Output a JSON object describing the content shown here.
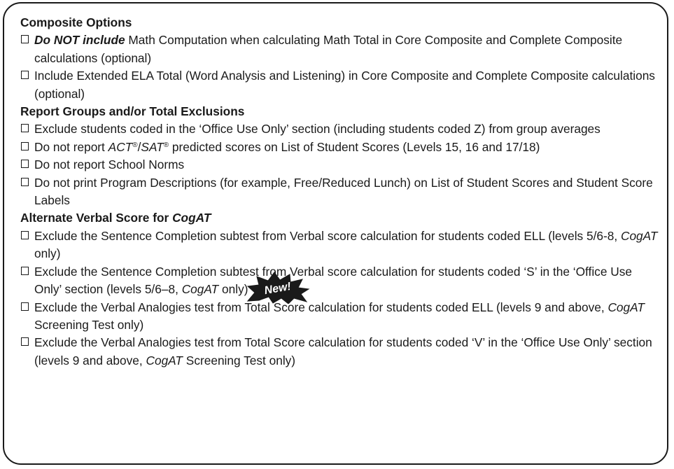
{
  "sections": [
    {
      "title": "Composite Options",
      "options": [
        {
          "prefix": "Do NOT include",
          "text": " Math Computation when calculating Math Total in Core Composite and Complete Composite calculations (optional)"
        },
        {
          "text": "Include Extended ELA Total (Word Analysis and Listening) in Core Composite and Complete Composite calculations (optional)"
        }
      ]
    },
    {
      "title": "Report Groups and/or Total Exclusions",
      "options": [
        {
          "text": "Exclude students coded in the ‘Office Use Only’ section (including students coded Z) from group averages"
        },
        {
          "pre": "Do not report ",
          "act": "ACT",
          "reg1": "®",
          "slash": "/",
          "sat": "SAT",
          "reg2": "®",
          "post": " predicted scores on List of Student Scores (Levels 15, 16 and 17/18)"
        },
        {
          "text": "Do not report School Norms"
        },
        {
          "text": "Do not print Program Descriptions (for example, Free/Reduced Lunch) on List of Student Scores and Student Score Labels"
        }
      ]
    },
    {
      "title_pre": "Alternate Verbal Score for ",
      "title_em": "CogAT",
      "badge": "New!",
      "options": [
        {
          "a": "Exclude the Sentence Completion subtest from Verbal score calculation for students coded ELL (levels 5/6-8, ",
          "em": "CogAT",
          "b": " only)"
        },
        {
          "a": "Exclude the Sentence Completion subtest from Verbal score calculation for students coded ‘S’ in the ‘Office Use Only’ section (levels 5/6–8, ",
          "em": "CogAT",
          "b": " only)"
        },
        {
          "a": "Exclude the Verbal Analogies test from Total Score calculation for students coded ELL (levels 9 and above, ",
          "em": "CogAT",
          "b": " Screening Test only)"
        },
        {
          "a": "Exclude the Verbal Analogies test from Total Score calculation for students coded ‘V’ in the ‘Office Use Only’ section (levels 9 and above, ",
          "em": "CogAT",
          "b": " Screening Test only)"
        }
      ]
    }
  ]
}
